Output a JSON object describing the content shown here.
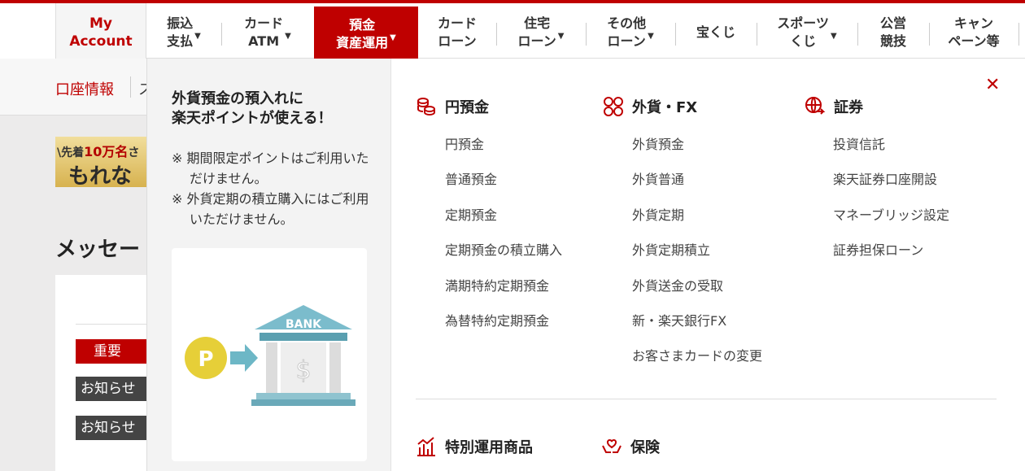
{
  "nav": {
    "account": "My\nAccount",
    "items": [
      {
        "label": "振込\n支払",
        "caret": "▼"
      },
      {
        "label": "カード\nATM",
        "caret": "▼"
      },
      {
        "label": "預金\n資産運用",
        "caret": "▼"
      },
      {
        "label": "カード\nローン",
        "caret": ""
      },
      {
        "label": "住宅\nローン",
        "caret": "▼"
      },
      {
        "label": "その他\nローン",
        "caret": "▼"
      },
      {
        "label": "宝くじ",
        "caret": ""
      },
      {
        "label": "スポーツ\nくじ",
        "caret": "▼"
      },
      {
        "label": "公営\n競技",
        "caret": ""
      },
      {
        "label": "キャン\nペーン等",
        "caret": ""
      }
    ]
  },
  "subnav": {
    "link": "口座情報",
    "cut": "ス"
  },
  "banner": {
    "prefix": "\\先着",
    "highlight": "10万名",
    "suffix": "さ",
    "big": "もれな"
  },
  "messages": {
    "title": "メッセー",
    "badges": [
      "重要",
      "お知らせ",
      "お知らせ"
    ]
  },
  "promo": {
    "title": "外貨預金の預入れに\n楽天ポイントが使える！",
    "notes": [
      "※ 期間限定ポイントはご利用いただけません。",
      "※ 外貨定期の積立購入にはご利用いただけません。"
    ],
    "bank_label": "BANK",
    "point_label": "P",
    "currency": "$"
  },
  "menu": {
    "close_icon": "close-icon",
    "columns": [
      {
        "title": "円預金",
        "icon": "coins-icon",
        "links": [
          "円預金",
          "普通預金",
          "定期預金",
          "定期預金の積立購入",
          "満期特約定期預金",
          "為替特約定期預金"
        ]
      },
      {
        "title": "外貨・FX",
        "icon": "currency-icon",
        "links": [
          "外貨預金",
          "外貨普通",
          "外貨定期",
          "外貨定期積立",
          "外貨送金の受取",
          "新・楽天銀行FX",
          "お客さまカードの変更"
        ]
      },
      {
        "title": "証券",
        "icon": "globe-icon",
        "links": [
          "投資信託",
          "楽天証券口座開設",
          "マネーブリッジ設定",
          "証券担保ローン"
        ]
      }
    ],
    "bottom": [
      {
        "title": "特別運用商品",
        "icon": "chart-icon"
      },
      {
        "title": "保険",
        "icon": "hands-heart-icon"
      }
    ]
  },
  "colors": {
    "brand": "#bf0000",
    "dark_badge": "#444444"
  }
}
